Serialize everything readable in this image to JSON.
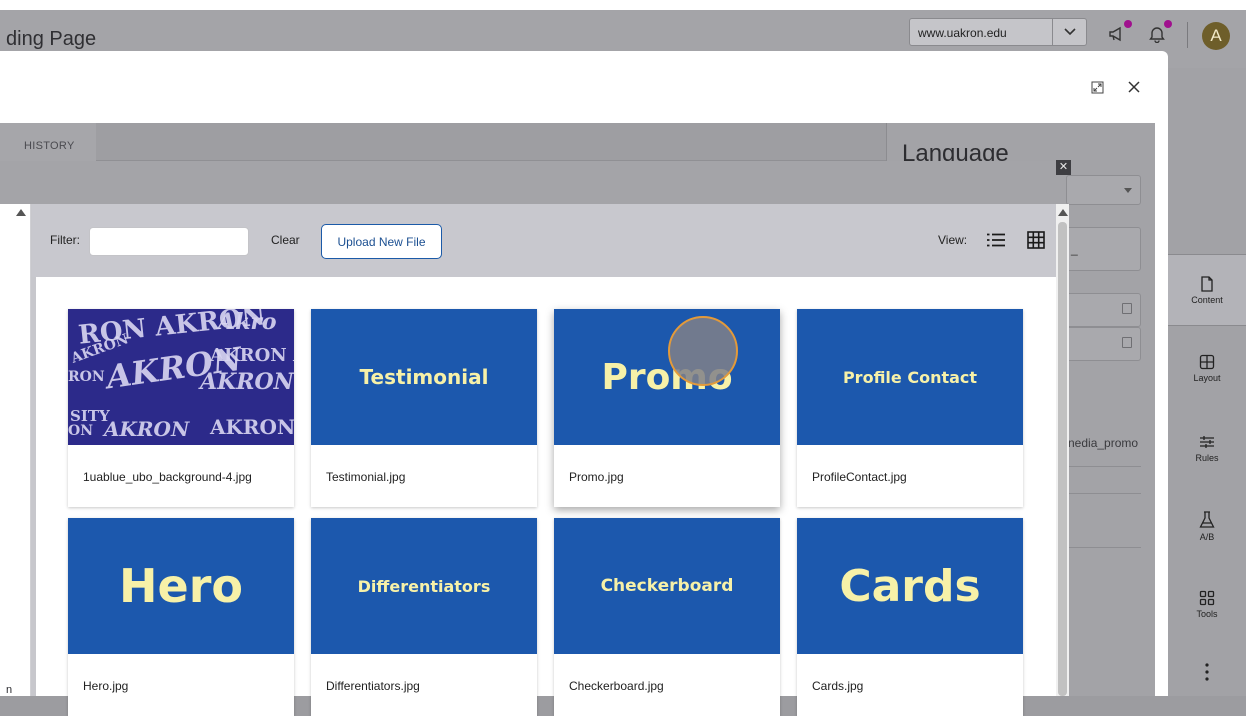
{
  "app": {
    "page_title": "ding Page",
    "domain_select": "www.uakron.edu",
    "avatar_initial": "A",
    "stray_text": "n"
  },
  "dialog": {
    "tabs": [
      {
        "label": "HISTORY"
      }
    ],
    "language_panel": {
      "title": "Language",
      "field_text": "_",
      "media_text": "nedia_promo"
    }
  },
  "file_picker": {
    "filter_label": "Filter:",
    "filter_value": "",
    "clear_label": "Clear",
    "upload_label": "Upload New File",
    "view_label": "View:",
    "files": [
      {
        "name": "1uablue_ubo_background-4.jpg",
        "thumb_text": ""
      },
      {
        "name": "Testimonial.jpg",
        "thumb_text": "Testimonial"
      },
      {
        "name": "Promo.jpg",
        "thumb_text": "Promo"
      },
      {
        "name": "ProfileContact.jpg",
        "thumb_text": "Profile Contact"
      },
      {
        "name": "Hero.jpg",
        "thumb_text": "Hero"
      },
      {
        "name": "Differentiators.jpg",
        "thumb_text": "Differentiators"
      },
      {
        "name": "Checkerboard.jpg",
        "thumb_text": "Checkerboard"
      },
      {
        "name": "Cards.jpg",
        "thumb_text": "Cards"
      }
    ]
  },
  "side_nav": {
    "items": [
      {
        "label": "Content",
        "icon": "file-icon"
      },
      {
        "label": "Layout",
        "icon": "layout-icon"
      },
      {
        "label": "Rules",
        "icon": "rules-icon"
      },
      {
        "label": "A/B",
        "icon": "flask-icon"
      },
      {
        "label": "Tools",
        "icon": "tools-icon"
      }
    ]
  },
  "colors": {
    "thumb_blue": "#1c58ad",
    "thumb_text": "#f7f1a8",
    "accent": "#1b5aa8",
    "notification_dot": "#a0108e",
    "avatar": "#6e5e2a"
  }
}
